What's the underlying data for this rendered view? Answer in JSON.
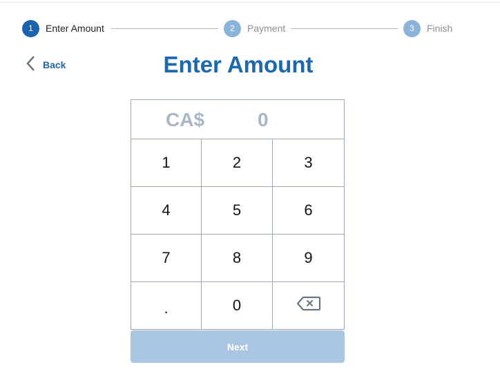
{
  "stepper": {
    "steps": [
      {
        "number": "1",
        "label": "Enter Amount",
        "state": "active",
        "circle_color": "#1a63ae",
        "label_color": "#222222"
      },
      {
        "number": "2",
        "label": "Payment",
        "state": "inactive",
        "circle_color": "#8ab3da",
        "label_color": "#8a8f94"
      },
      {
        "number": "3",
        "label": "Finish",
        "state": "inactive",
        "circle_color": "#8ab3da",
        "label_color": "#8a8f94"
      }
    ]
  },
  "nav": {
    "back_label": "Back",
    "back_icon": "chevron-left-icon"
  },
  "page": {
    "title": "Enter Amount"
  },
  "amount_display": {
    "currency": "CA$",
    "value": "0"
  },
  "keypad": {
    "keys": [
      "1",
      "2",
      "3",
      "4",
      "5",
      "6",
      "7",
      "8",
      "9",
      ".",
      "0"
    ],
    "backspace_icon": "backspace-icon"
  },
  "actions": {
    "next_label": "Next",
    "next_disabled": true
  },
  "colors": {
    "accent": "#1a68b3",
    "disabled_button": "#a8c6e3",
    "muted_text": "#a9b7c5"
  }
}
